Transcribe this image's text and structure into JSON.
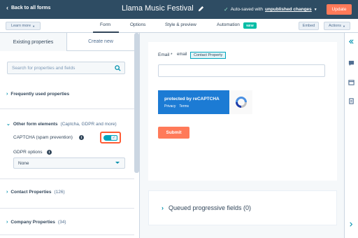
{
  "topbar": {
    "back_label": "Back to all forms",
    "form_title": "Llama Music Festival",
    "autosave_prefix": "Auto-saved with",
    "autosave_changes": "unpublished changes",
    "update_label": "Update"
  },
  "subnav": {
    "learn_more": "Learn more",
    "tabs": [
      "Form",
      "Options",
      "Style & preview",
      "Automation"
    ],
    "new_badge": "NEW",
    "embed": "Embed",
    "actions": "Actions"
  },
  "left_panel": {
    "tabs": [
      "Existing properties",
      "Create new"
    ],
    "search_placeholder": "Search for properties and fields",
    "frequently_used": "Frequently used properties",
    "other_elements": "Other form elements",
    "other_elements_note": "(Captcha, GDPR and more)",
    "captcha_label": "CAPTCHA (spam prevention)",
    "captcha_enabled": true,
    "gdpr_label": "GDPR options",
    "gdpr_value": "None",
    "contact_properties": "Contact Properties",
    "contact_count": "(126)",
    "company_properties": "Company Properties",
    "company_count": "(34)"
  },
  "form_preview": {
    "email_label": "Email *",
    "email_sub": "email",
    "contact_tag": "Contact Property",
    "recaptcha_title": "protected by reCAPTCHA",
    "recaptcha_privacy": "Privacy",
    "recaptcha_terms": "Terms",
    "submit_label": "Submit",
    "queued_label": "Queued progressive fields (0)"
  },
  "colors": {
    "topbar": "#2e4c63",
    "accent_orange": "#ff7a59",
    "teal": "#00a4bd",
    "recaptcha_blue": "#1c7bd4"
  }
}
